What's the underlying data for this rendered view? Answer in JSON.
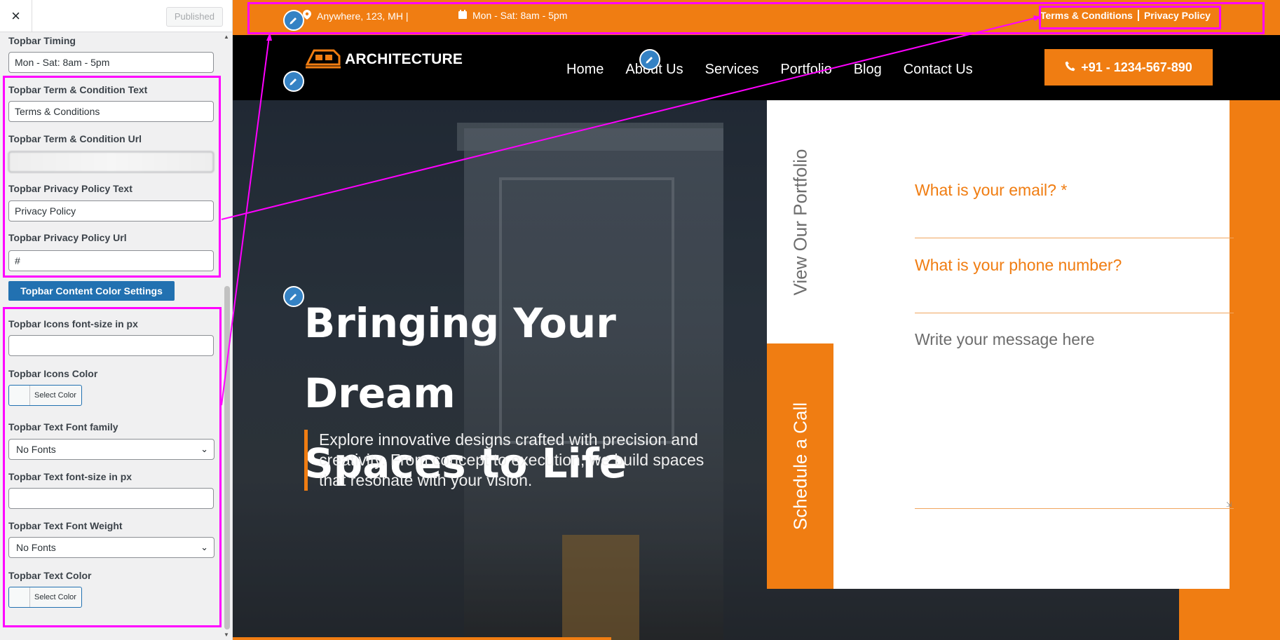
{
  "sidebar": {
    "close_icon": "×",
    "publish_label": "Published",
    "fields": {
      "timing_label": "Topbar Timing",
      "timing_value": "Mon - Sat: 8am - 5pm",
      "term_text_label": "Topbar Term & Condition Text",
      "term_text_value": "Terms & Conditions",
      "term_url_label": "Topbar Term & Condition Url",
      "privacy_text_label": "Topbar Privacy Policy Text",
      "privacy_text_value": "Privacy Policy",
      "privacy_url_label": "Topbar Privacy Policy Url",
      "privacy_url_value": "#",
      "color_settings_button": "Topbar Content Color Settings",
      "icons_size_label": "Topbar Icons font-size in px",
      "icons_color_label": "Topbar Icons Color",
      "select_color": "Select Color",
      "font_family_label": "Topbar Text Font family",
      "font_family_value": "No Fonts",
      "font_size_label": "Topbar Text font-size in px",
      "font_weight_label": "Topbar Text Font Weight",
      "font_weight_value": "No Fonts",
      "text_color_label": "Topbar Text Color"
    }
  },
  "site": {
    "topbar": {
      "address": "Anywhere, 123, MH |",
      "hours": "Mon - Sat: 8am - 5pm",
      "terms": "Terms & Conditions",
      "privacy": "Privacy Policy"
    },
    "logo_text": "ARCHITECTURE",
    "nav": [
      "Home",
      "About Us",
      "Services",
      "Portfolio",
      "Blog",
      "Contact Us"
    ],
    "phone": "+91 - 1234-567-890",
    "hero": {
      "title_line1": "Bringing Your Dream",
      "title_line2": "Spaces to Life",
      "description": "Explore innovative designs crafted with precision and creativity. From concept to execution, we build spaces that resonate with your vision."
    },
    "side_tabs": {
      "portfolio": "View Our Portfolio",
      "schedule": "Schedule a Call"
    },
    "form": {
      "email_label": "What is your email? *",
      "phone_label": "What is your phone number?",
      "message_placeholder": "Write your message here"
    }
  },
  "colors": {
    "accent": "#f07d12",
    "highlight": "#ff00ff",
    "wp_blue": "#2271b1"
  }
}
